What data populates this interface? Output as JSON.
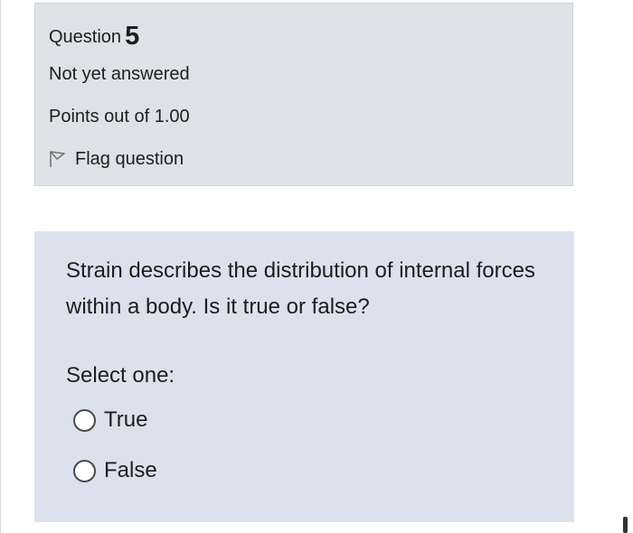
{
  "question": {
    "title_label": "Question",
    "number": "5",
    "state": "Not yet answered",
    "grade": "Points out of 1.00",
    "flag_label": "Flag question",
    "flag_icon": "flag-icon"
  },
  "content": {
    "question_text": "Strain describes the distribution of internal forces within a body.  Is it true or false?",
    "prompt": "Select one:",
    "options": [
      {
        "label": "True",
        "selected": false
      },
      {
        "label": "False",
        "selected": false
      }
    ]
  }
}
